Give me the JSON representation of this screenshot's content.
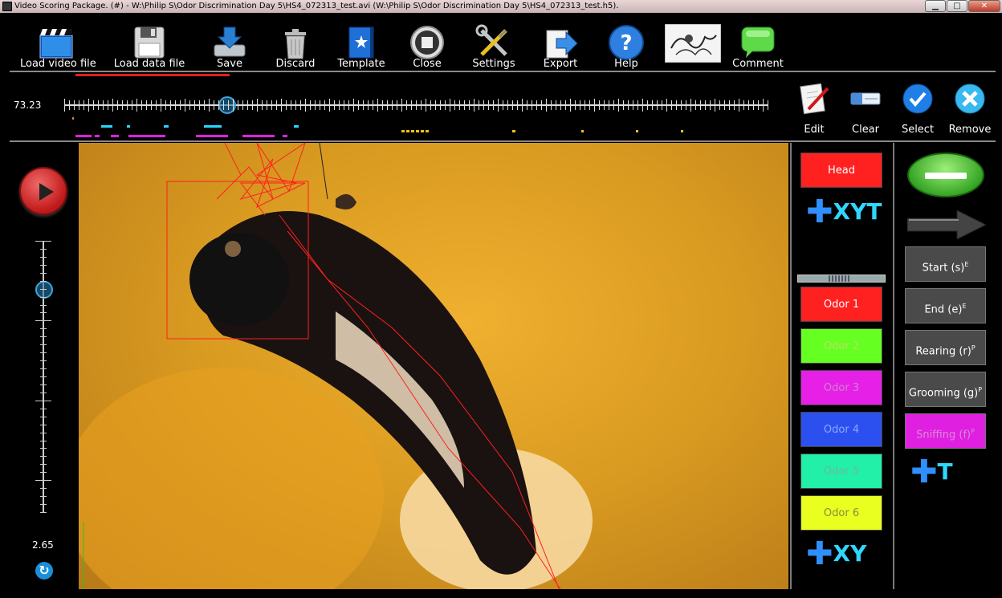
{
  "window": {
    "title": "Video Scoring Package. (#) - W:\\Philip S\\Odor Discrimination Day 5\\HS4_072313_test.avi (W:\\Philip S\\Odor Discrimination Day 5\\HS4_072313_test.h5).",
    "minimize": "▁",
    "maximize": "□",
    "close": "✕"
  },
  "toolbar": {
    "items": [
      {
        "label": "Load video file",
        "icon": "clapperboard-icon"
      },
      {
        "label": "Load data file",
        "icon": "floppy-disk-icon"
      },
      {
        "label": "Save",
        "icon": "save-download-icon"
      },
      {
        "label": "Discard",
        "icon": "trash-can-icon"
      },
      {
        "label": "Template",
        "icon": "template-book-icon"
      },
      {
        "label": "Close",
        "icon": "stop-circle-icon"
      },
      {
        "label": "Settings",
        "icon": "wrench-screwdriver-icon"
      },
      {
        "label": "Export",
        "icon": "export-arrow-icon"
      },
      {
        "label": "Help",
        "icon": "help-question-icon"
      },
      {
        "label": "",
        "icon": "sketch-thumbnail-icon"
      },
      {
        "label": "Comment",
        "icon": "speech-bubble-icon"
      }
    ]
  },
  "timeline": {
    "time": "73.23",
    "position_fraction": 0.232,
    "tools": [
      {
        "label": "Edit",
        "icon": "edit-pencil-icon"
      },
      {
        "label": "Clear",
        "icon": "eraser-icon"
      },
      {
        "label": "Select",
        "icon": "checkmark-icon"
      },
      {
        "label": "Remove",
        "icon": "remove-x-icon"
      }
    ]
  },
  "playback": {
    "speed": "2.65",
    "speed_fraction": 0.82
  },
  "markers": {
    "head_label": "Head",
    "head_color": "#ff2020",
    "add_xyt_label": "XYT",
    "odors": [
      {
        "label": "Odor 1",
        "color": "#ff2020",
        "text_color": "#ffffff"
      },
      {
        "label": "Odor 2",
        "color": "#66ff22",
        "text_color": "#b8e060"
      },
      {
        "label": "Odor 3",
        "color": "#e620e6",
        "text_color": "#d080d0"
      },
      {
        "label": "Odor 4",
        "color": "#2c50f0",
        "text_color": "#8aa8ff"
      },
      {
        "label": "Odor 5",
        "color": "#22f0a8",
        "text_color": "#6ab8a0"
      },
      {
        "label": "Odor 6",
        "color": "#e8ff20",
        "text_color": "#8a8a40"
      }
    ],
    "add_xy_label": "XY"
  },
  "events": {
    "items": [
      {
        "label": "Start (s)",
        "sup": "E"
      },
      {
        "label": "End (e)",
        "sup": "E"
      },
      {
        "label": "Rearing (r)",
        "sup": "P"
      },
      {
        "label": "Grooming (g)",
        "sup": "P"
      },
      {
        "label": "Sniffing (f)",
        "sup": "P"
      }
    ],
    "add_t_label": "T"
  }
}
